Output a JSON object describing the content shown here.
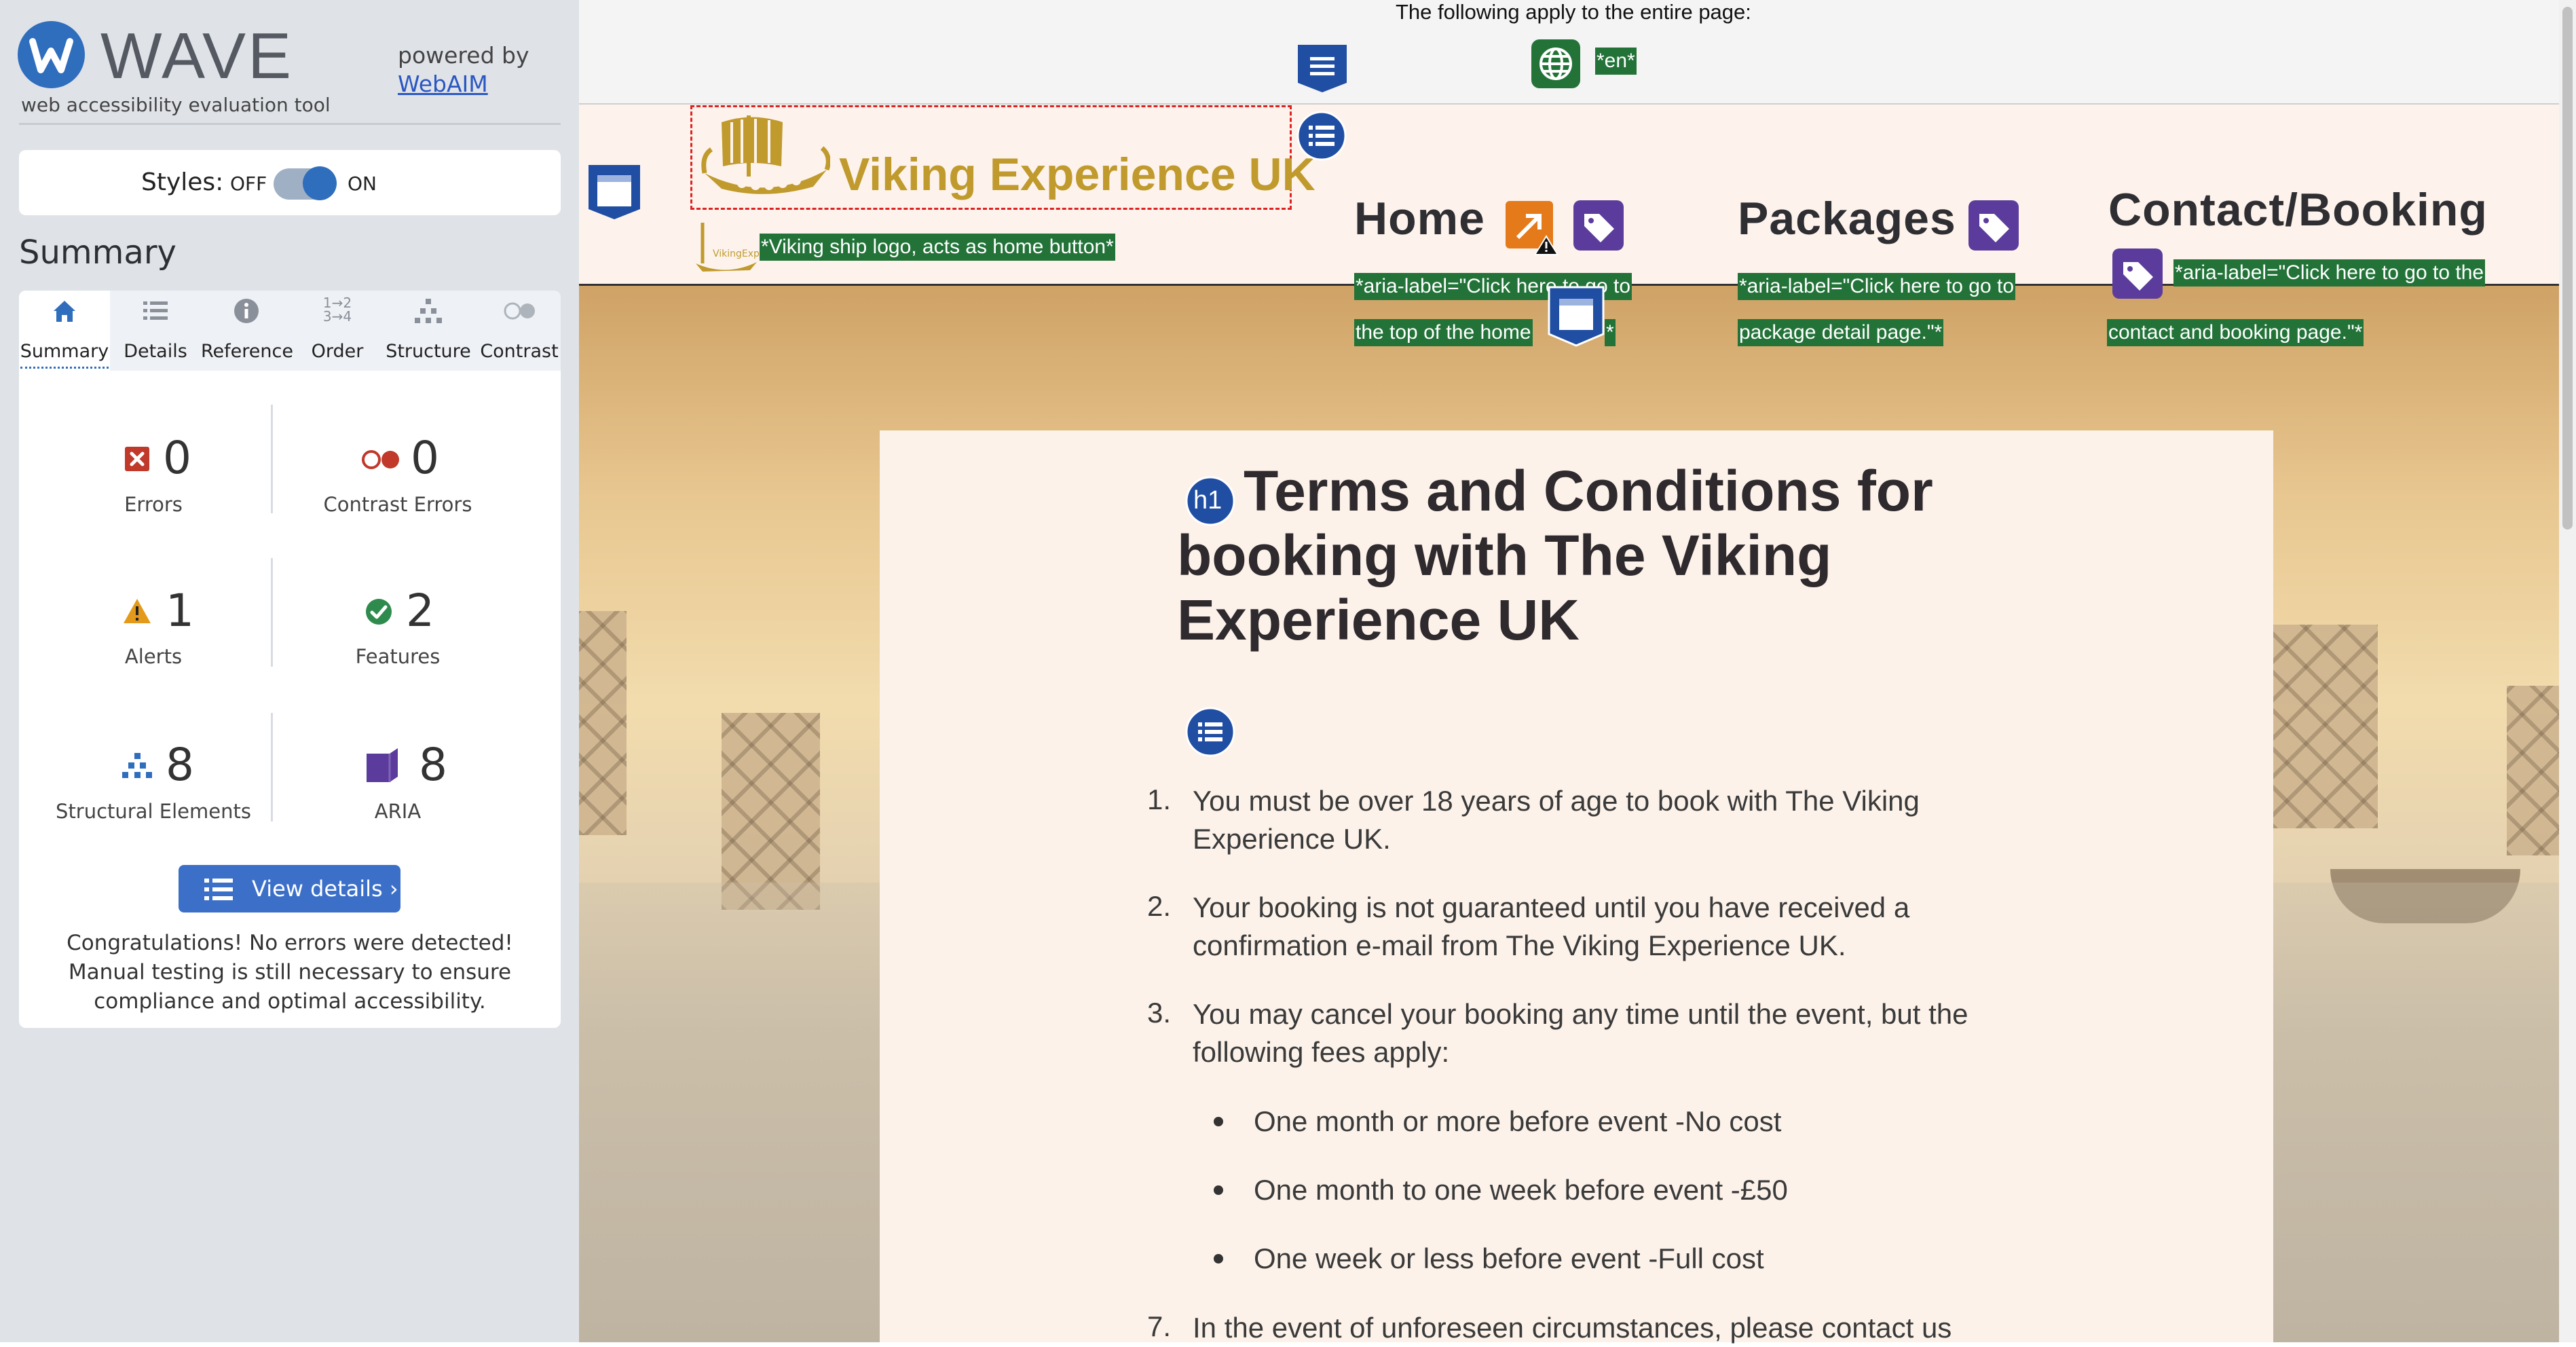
{
  "wave": {
    "brand": "WAVE",
    "tagline": "web accessibility evaluation tool",
    "powered_by": "powered by",
    "webaim_link": "WebAIM",
    "styles_label": "Styles:",
    "styles_off": "OFF",
    "styles_on": "ON",
    "summary_heading": "Summary",
    "tabs": [
      {
        "label": "Summary",
        "icon": "home-icon"
      },
      {
        "label": "Details",
        "icon": "list-icon"
      },
      {
        "label": "Reference",
        "icon": "info-icon"
      },
      {
        "label": "Order",
        "icon": "order-icon"
      },
      {
        "label": "Structure",
        "icon": "structure-icon"
      },
      {
        "label": "Contrast",
        "icon": "contrast-icon"
      }
    ],
    "stats": {
      "errors": {
        "value": "0",
        "label": "Errors"
      },
      "contrast_errors": {
        "value": "0",
        "label": "Contrast Errors"
      },
      "alerts": {
        "value": "1",
        "label": "Alerts"
      },
      "features": {
        "value": "2",
        "label": "Features"
      },
      "structural": {
        "value": "8",
        "label": "Structural Elements"
      },
      "aria": {
        "value": "8",
        "label": "ARIA"
      }
    },
    "view_details": "View details ›",
    "congrats": "Congratulations! No errors were detected! Manual testing is still necessary to ensure compliance and optimal accessibility.",
    "colors": {
      "accent": "#2f6dbd",
      "error": "#c0392b",
      "alert": "#e39a1a",
      "feature": "#2f8a4d",
      "aria": "#5b3c9c"
    }
  },
  "page": {
    "strip_text": "The following apply to the entire page:",
    "lang_tag": "*en*",
    "site_name": "Viking Experience UK",
    "logo_alt": "*Viking ship logo, acts as home button*",
    "nav": {
      "home": "Home",
      "packages": "Packages",
      "contact": "Contact/Booking"
    },
    "aria_labels": {
      "home_line1": "*aria-label=\"Click here to go to",
      "home_line2": "the top of the home",
      "home_end": "*",
      "packages_line1": "*aria-label=\"Click here to go to",
      "packages_line2": "package detail page.\"*",
      "contact_line1": "*aria-label=\"Click here to go to the",
      "contact_line2": "contact and booking page.\"*"
    },
    "h1_badge": "h1",
    "h1": "Terms and Conditions for booking with The Viking Experience UK",
    "terms": [
      {
        "num": "1.",
        "text": "You must be over 18 years of age to book with The Viking Experience UK."
      },
      {
        "num": "2.",
        "text": "Your booking is not guaranteed until you have received a confirmation e-mail from The Viking Experience UK."
      },
      {
        "num": "3.",
        "text": "You may cancel your booking any time until the event, but the following fees apply:"
      }
    ],
    "fees": [
      "One month or more before event -No cost",
      "One month to one week before event -£50",
      "One week or less before event -Full cost"
    ],
    "term7": {
      "num": "7.",
      "text": "In the event of unforeseen circumstances, please contact us"
    }
  }
}
